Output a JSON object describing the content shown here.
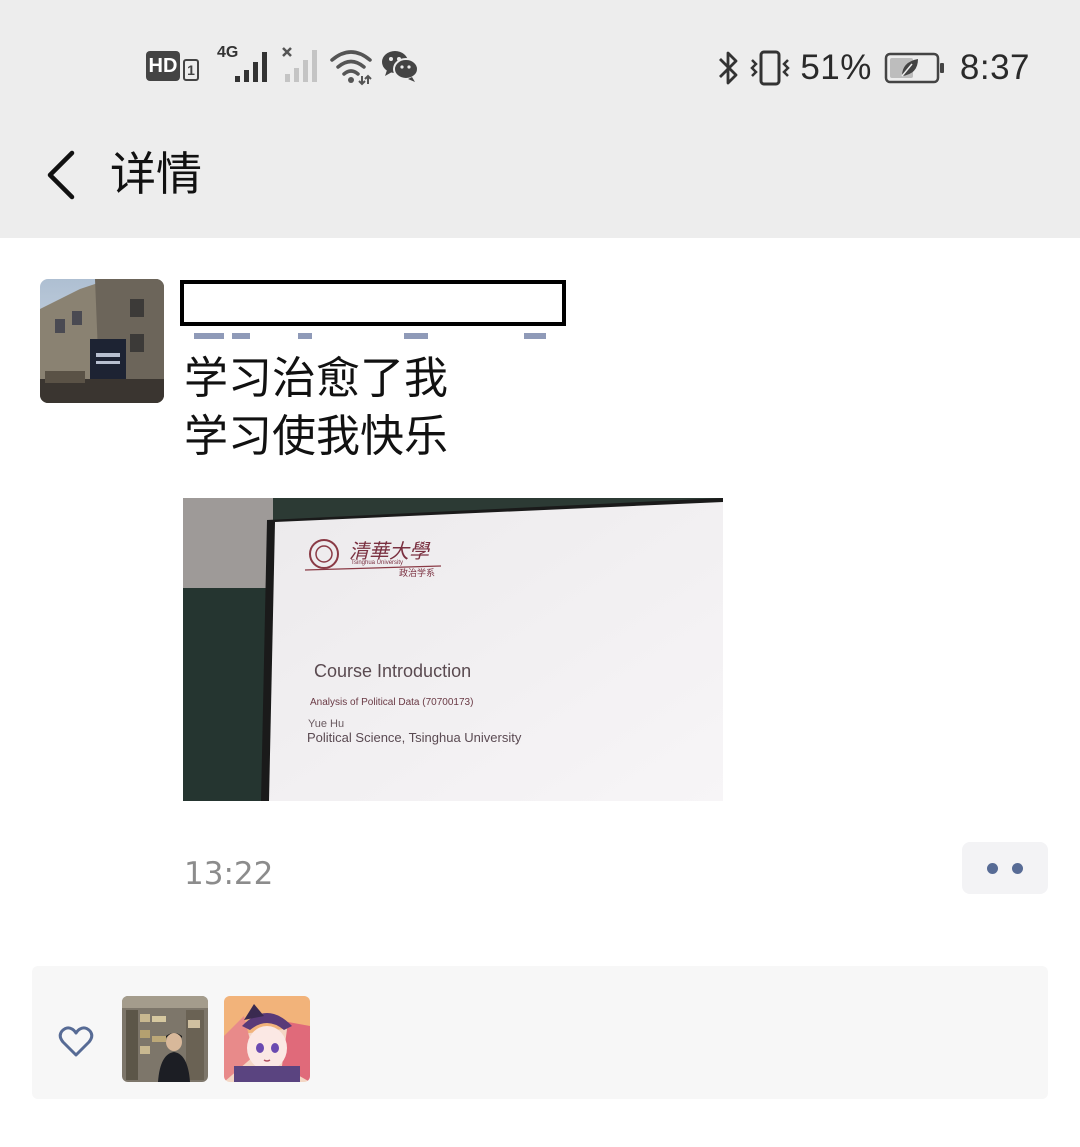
{
  "status_bar": {
    "hd_label": "HD",
    "sim_label": "1",
    "network_label": "4G",
    "battery_percent": "51%",
    "battery_level": 0.51,
    "time": "8:37",
    "icons": [
      "hd-icon",
      "signal-4g-icon",
      "signal-no-service-icon",
      "wifi-icon",
      "wechat-icon",
      "bluetooth-icon",
      "vibrate-icon",
      "battery-icon"
    ]
  },
  "header": {
    "title": "详情",
    "back_icon": "chevron-left-icon"
  },
  "post": {
    "username": "",
    "lines": [
      "学习治愈了我",
      "学习使我快乐"
    ],
    "image": {
      "slide_logo_cn": "清華大學",
      "slide_logo_en": "Tsinghua University",
      "slide_dept": "政治学系",
      "slide_title": "Course Introduction",
      "slide_course": "Analysis of Political Data (70700173)",
      "slide_author": "Yue Hu",
      "slide_affiliation": "Political Science, Tsinghua University"
    },
    "time": "13:22",
    "more_icon": "more-dots-icon"
  },
  "likes": {
    "icon": "heart-icon",
    "count_shown": 2
  },
  "colors": {
    "header_bg": "#ededed",
    "link_blue": "#576b95",
    "time_grey": "#8c8c8c",
    "likes_bg": "#f7f7f7"
  }
}
